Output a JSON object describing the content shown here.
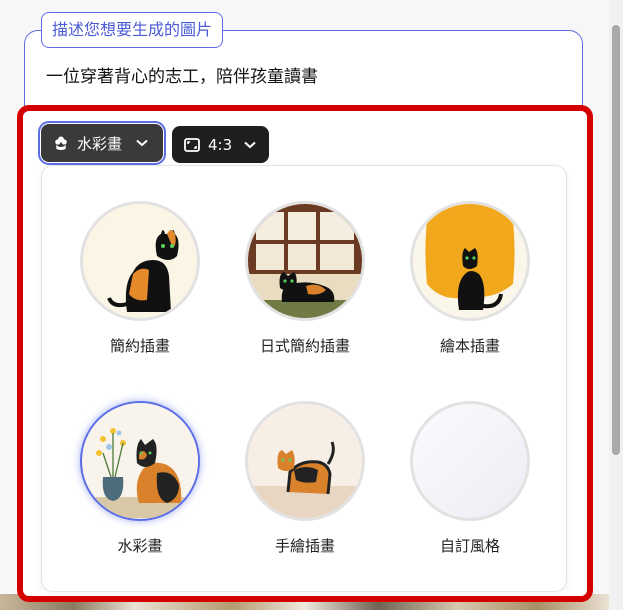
{
  "prompt": {
    "legend": "描述您想要生成的圖片",
    "text": "一位穿著背心的志工，陪伴孩童讀書"
  },
  "toolbar": {
    "style_chip": {
      "label": "水彩畫",
      "icon": "flower-icon"
    },
    "ratio_chip": {
      "label": "4:3",
      "icon": "aspect-ratio-icon"
    }
  },
  "style_options": [
    {
      "label": "簡約插畫",
      "selected": false
    },
    {
      "label": "日式簡約插畫",
      "selected": false
    },
    {
      "label": "繪本插畫",
      "selected": false
    },
    {
      "label": "水彩畫",
      "selected": true
    },
    {
      "label": "手繪插畫",
      "selected": false
    },
    {
      "label": "自訂風格",
      "selected": false
    }
  ],
  "colors": {
    "accent": "#5b6ee6",
    "highlight": "#d40000",
    "chip_bg": "#1f1f1f"
  }
}
